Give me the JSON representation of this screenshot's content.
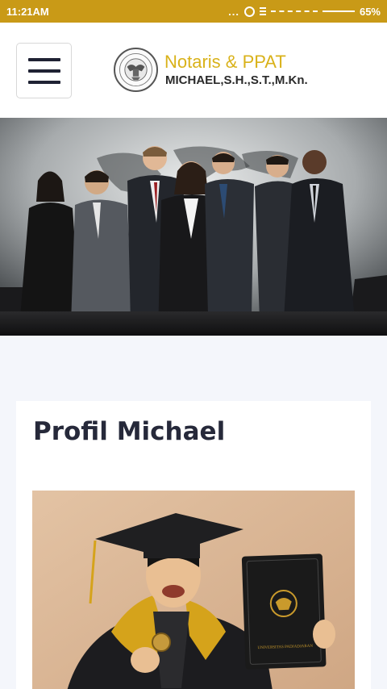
{
  "status_bar": {
    "time": "11:21AM",
    "dots": "...",
    "battery": "65%",
    "icons": [
      "alarm-icon",
      "signal-icon",
      "wifi-icon"
    ]
  },
  "header": {
    "menu_icon": "hamburger-menu-icon",
    "logo_title": "Notaris & PPAT",
    "logo_subtitle": "MICHAEL,S.H.,S.T.,M.Kn.",
    "seal_text": "NOTARIS & PPAT"
  },
  "hero": {
    "image": "group-business-people-photo"
  },
  "profile": {
    "title": "Profil Michael",
    "image": "graduation-photo",
    "folder_text": "UNIVERSITAS PADJADJARAN"
  },
  "colors": {
    "status_bar": "#c99a17",
    "logo_gold": "#d9b21a",
    "text_dark": "#26293a",
    "page_bg": "#f4f6fb"
  }
}
